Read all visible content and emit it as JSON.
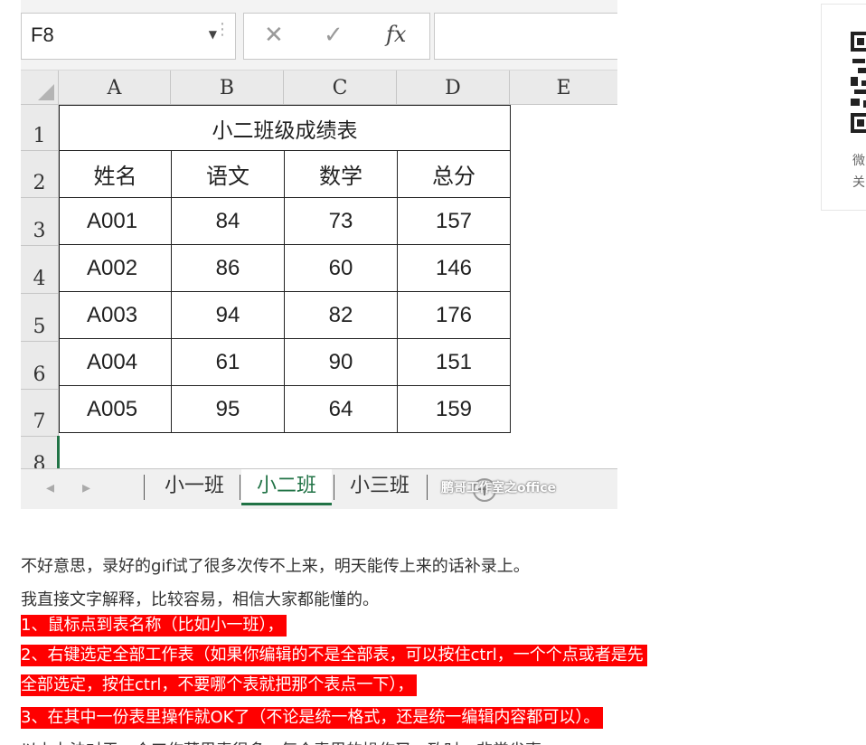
{
  "excel": {
    "name_box": "F8",
    "columns": [
      "A",
      "B",
      "C",
      "D",
      "E"
    ],
    "rows": [
      "1",
      "2",
      "3",
      "4",
      "5",
      "6",
      "7",
      "8"
    ],
    "table_title": "小二班级成绩表",
    "headers": [
      "姓名",
      "语文",
      "数学",
      "总分"
    ],
    "records": [
      [
        "A001",
        "84",
        "73",
        "157"
      ],
      [
        "A002",
        "86",
        "60",
        "146"
      ],
      [
        "A003",
        "94",
        "82",
        "176"
      ],
      [
        "A004",
        "61",
        "90",
        "151"
      ],
      [
        "A005",
        "95",
        "64",
        "159"
      ]
    ],
    "sheet_tabs": [
      "小一班",
      "小二班",
      "小三班"
    ],
    "active_tab": "小二班",
    "watermark": "鹏哥工作室之office",
    "accent_color": "#217346"
  },
  "side_card": {
    "line1": "微",
    "line2": "关"
  },
  "article": {
    "p1": "不好意思，录好的gif试了很多次传不上来，明天能传上来的话补录上。",
    "p2": "我直接文字解释，比较容易，相信大家都能懂的。",
    "highlights": [
      "1、鼠标点到表名称（比如小一班），",
      "2、右键选定全部工作表（如果你编辑的不是全部表，可以按住ctrl，一个个点或者是先",
      "全部选定，按住ctrl，不要哪个表就把那个表点一下），",
      "3、在其中一份表里操作就OK了（不论是统一格式，还是统一编辑内容都可以）。"
    ],
    "p_last": "以上办法对于一个工作薄里表很多，每个表里的操作又一致时，非常省事。",
    "highlight_color": "#ff0000"
  }
}
